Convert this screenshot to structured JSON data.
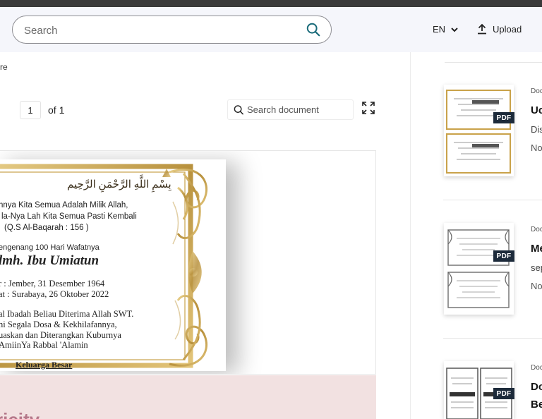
{
  "header": {
    "search_placeholder": "Search",
    "language": "EN",
    "upload_label": "Upload"
  },
  "breadcrumb": "re",
  "pager": {
    "current_page": "1",
    "of_label": "of 1"
  },
  "doc_search_placeholder": "Search document",
  "document": {
    "arabic_basmala": "بِسْمِ اللَّهِ الرَّحْمَنِ الرَّحِيم",
    "line1": "nnya Kita Semua Adalah Milik Allah,",
    "line2": "la-Nya Lah Kita Semua Pasti Kembali",
    "line3": "(Q.S Al-Baqarah : 156 )",
    "line4": "engenang 100 Hari Wafatnya",
    "name": "lmh. Ibu Umiatun",
    "born": "r : Jember, 31 Desember 1964",
    "died": "at : Surabaya, 26 Oktober 2022",
    "prayer1": "al Ibadah Beliau Diterima Allah SWT.",
    "prayer2": "ni Segala Dosa & Kekhilafannya,",
    "prayer3": "uaskan dan Diterangkan Kuburnya",
    "prayer4": "AmiinYa Rabbal 'Alamin",
    "family": "Keluarga Besar"
  },
  "pink_banner_text": "ricity",
  "related": [
    {
      "meta": "Doc",
      "title": "Uc",
      "sub": "Dis",
      "no": "No",
      "badge": "PDF"
    },
    {
      "meta": "Doc",
      "title": "Me",
      "sub": "sep",
      "no": "No",
      "badge": "PDF"
    },
    {
      "meta": "Doc",
      "title": "Do",
      "sub": "Be",
      "no": "",
      "badge": "PDF"
    }
  ],
  "colors": {
    "header_bg": "#f5f6fb",
    "gold": "#c9a24a",
    "pink": "#f2e1e1",
    "badge": "#1c2a3a"
  }
}
